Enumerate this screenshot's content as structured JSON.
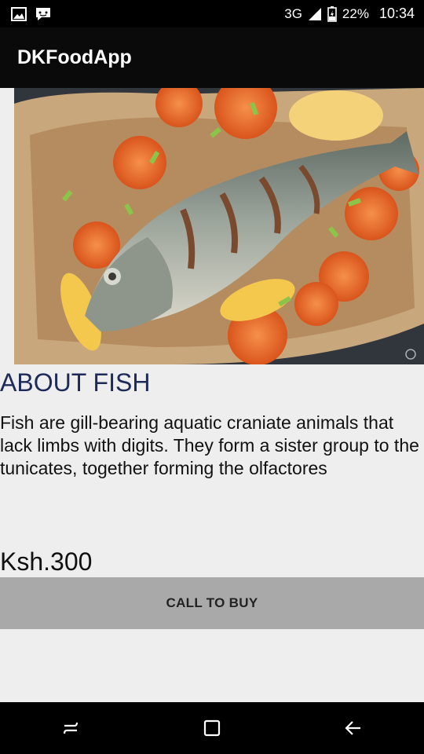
{
  "status_bar": {
    "network": "3G",
    "battery": "22%",
    "time": "10:34",
    "icons": [
      "image-icon",
      "chat-icon",
      "signal-icon",
      "battery-icon"
    ]
  },
  "app_bar": {
    "title": "DKFoodApp"
  },
  "product": {
    "image_name": "baked-fish-image",
    "title": "ABOUT FISH",
    "description": "Fish are gill-bearing aquatic craniate animals that lack limbs with digits. They form a sister group to the tunicates, together forming the olfactores",
    "price": "Ksh.300",
    "buy_label": "CALL TO BUY"
  },
  "nav_bar": {
    "icons": [
      "recent-apps-icon",
      "home-icon",
      "back-icon"
    ]
  },
  "colors": {
    "background": "#eeeeee",
    "app_bar": "#0a0a0a",
    "title_text": "#1e2b5a",
    "button": "#a9a9a9"
  }
}
